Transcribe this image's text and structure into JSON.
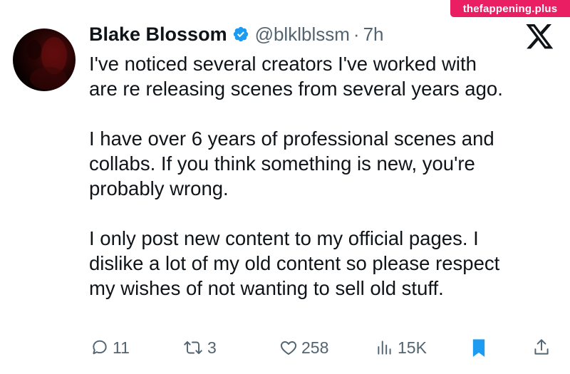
{
  "watermark": {
    "text": "thefappening.plus"
  },
  "tweet": {
    "author": {
      "display_name": "Blake Blossom",
      "handle": "@blklblssm",
      "separator": "·",
      "time": "7h",
      "verified": true
    },
    "paragraphs": [
      "I've noticed several creators I've worked with\nare re releasing scenes from several years ago.",
      "I have over 6 years of professional scenes and\ncollabs. If you think something is new, you're\nprobably wrong.",
      "I only post new content to my official pages. I\ndislike a lot of my old content so please respect\nmy wishes of not wanting to sell old stuff."
    ]
  },
  "actions": {
    "replies": "11",
    "reposts": "3",
    "likes": "258",
    "views": "15K"
  },
  "icons": {
    "verified": "verified-badge-icon",
    "platform": "x-logo-icon",
    "reply": "reply-icon",
    "repost": "repost-icon",
    "like": "heart-icon",
    "views": "views-icon",
    "bookmark": "bookmark-icon",
    "share": "share-icon"
  },
  "colors": {
    "text": "#0f1419",
    "muted": "#536471",
    "verified": "#1d9bf0",
    "bookmark": "#1d9bf0",
    "watermark_bg": "#e91e63"
  }
}
